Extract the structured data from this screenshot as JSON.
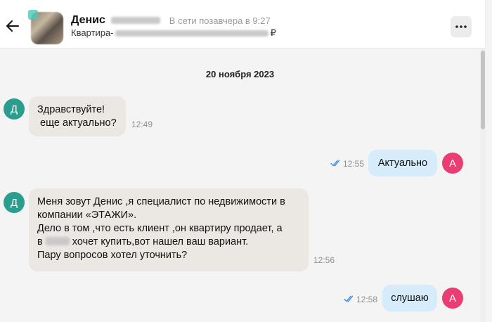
{
  "header": {
    "contact_name": "Денис",
    "status": "В сети позавчера в 9:27",
    "listing_prefix": "Квартира-",
    "currency": "₽",
    "more_label": "•••"
  },
  "chat": {
    "date_separator": "20 ноября 2023",
    "messages": [
      {
        "direction": "incoming",
        "avatar_letter": "Д",
        "lines": [
          "Здравствуйте!",
          " еще актуально?"
        ],
        "time": "12:49"
      },
      {
        "direction": "outgoing",
        "avatar_letter": "А",
        "text": "Актуально",
        "time": "12:55",
        "read": true
      },
      {
        "direction": "incoming",
        "avatar_letter": "Д",
        "lines": [
          "Меня зовут Денис ,я специалист по недвижимости в",
          "компании «ЭТАЖИ».",
          "Дело в том ,что есть клиент ,он квартиру продает, а",
          "в",
          " хочет купить,вот нашел ваш вариант.",
          "Пару вопросов хотел уточнить?"
        ],
        "time": "12:56"
      },
      {
        "direction": "outgoing",
        "avatar_letter": "А",
        "text": "слушаю",
        "time": "12:58",
        "read": true
      }
    ]
  },
  "colors": {
    "incoming_bubble": "#ebe8e3",
    "outgoing_bubble": "#d6ecfb",
    "incoming_avatar": "#2a9d8f",
    "outgoing_avatar": "#ea3d72",
    "read_check": "#3d8fe0"
  },
  "icons": {
    "back": "arrow-left-icon",
    "more": "more-dots-icon",
    "read": "double-check-icon"
  }
}
